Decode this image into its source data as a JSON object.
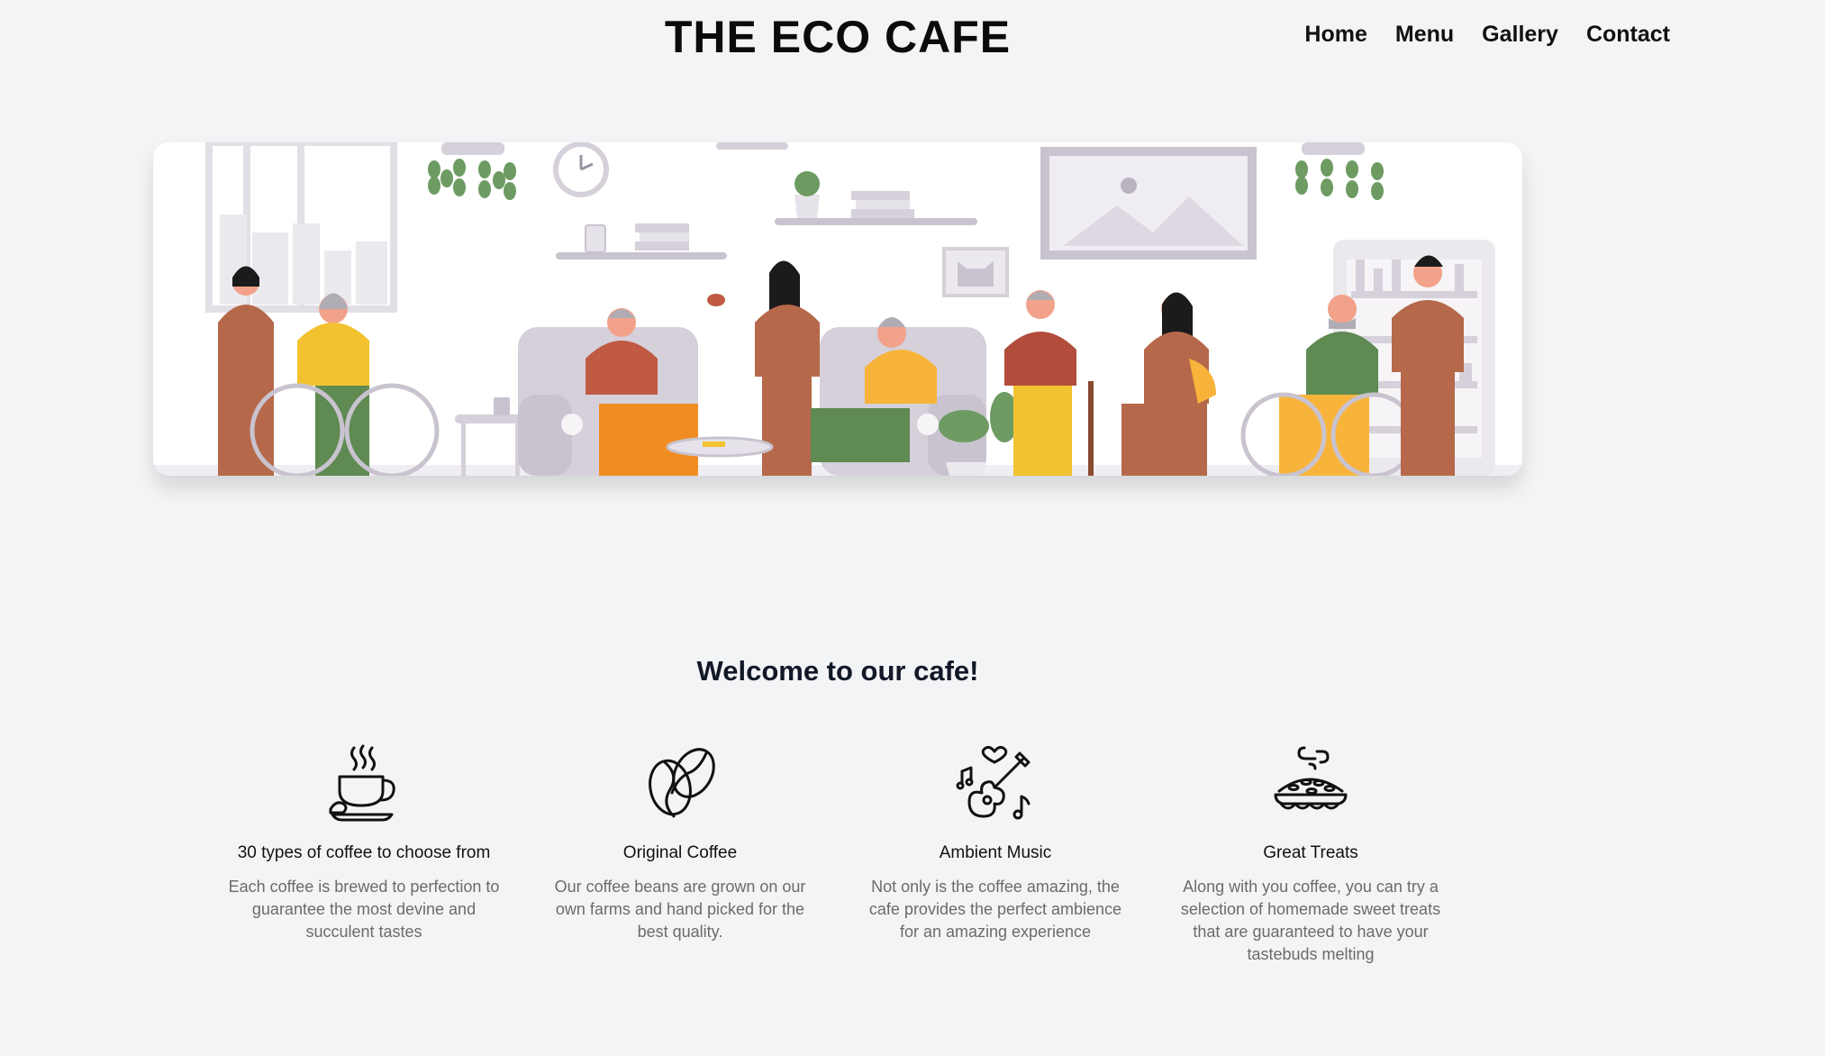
{
  "header": {
    "title": "THE ECO CAFE",
    "nav": [
      "Home",
      "Menu",
      "Gallery",
      "Contact"
    ]
  },
  "hero": {
    "image": "cafe-illustration"
  },
  "welcome": {
    "heading": "Welcome to our cafe!"
  },
  "features": [
    {
      "icon": "coffee-cup-icon",
      "title": "30 types of coffee to choose from",
      "text": "Each coffee is brewed to perfection to guarantee the most devine and succulent tastes"
    },
    {
      "icon": "coffee-bean-icon",
      "title": "Original Coffee",
      "text": "Our coffee beans are grown on our own farms and hand picked for the best quality."
    },
    {
      "icon": "guitar-music-icon",
      "title": "Ambient Music",
      "text": "Not only is the coffee amazing, the cafe provides the perfect ambience for an amazing experience"
    },
    {
      "icon": "pie-treat-icon",
      "title": "Great Treats",
      "text": "Along with you coffee, you can try a selection of homemade sweet treats that are guaranteed to have your tastebuds melting"
    }
  ],
  "colors": {
    "background": "#f3f4f6",
    "brown": "#b5694a",
    "yellow": "#f2c230",
    "green": "#5f8a52",
    "orange": "#f08d22",
    "gray": "#c9c3cf"
  }
}
